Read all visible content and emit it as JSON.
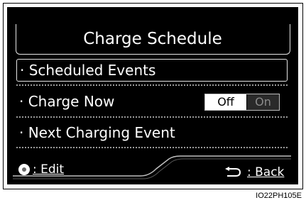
{
  "header": {
    "title": "Charge Schedule"
  },
  "menu": {
    "items": [
      {
        "label": "· Scheduled Events"
      },
      {
        "label": "· Charge Now"
      },
      {
        "label": "· Next Charging Event"
      }
    ],
    "charge_now_toggle": {
      "off_label": "Off",
      "on_label": "On",
      "selected": "Off"
    }
  },
  "footer": {
    "edit_label": ": Edit",
    "back_label": ": Back"
  },
  "caption": "IO22PH105E"
}
